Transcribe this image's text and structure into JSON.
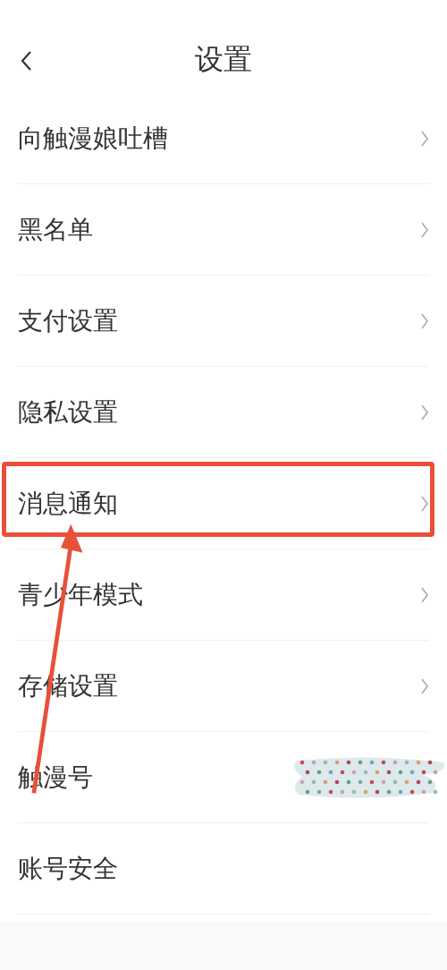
{
  "header": {
    "title": "设置"
  },
  "items": [
    {
      "label": "向触漫娘吐槽",
      "chevron": true,
      "highlighted": false,
      "redacted": false
    },
    {
      "label": "黑名单",
      "chevron": true,
      "highlighted": false,
      "redacted": false
    },
    {
      "label": "支付设置",
      "chevron": true,
      "highlighted": false,
      "redacted": false
    },
    {
      "label": "隐私设置",
      "chevron": true,
      "highlighted": false,
      "redacted": false
    },
    {
      "label": "消息通知",
      "chevron": true,
      "highlighted": true,
      "redacted": false
    },
    {
      "label": "青少年模式",
      "chevron": true,
      "highlighted": false,
      "redacted": false
    },
    {
      "label": "存储设置",
      "chevron": true,
      "highlighted": false,
      "redacted": false
    },
    {
      "label": "触漫号",
      "chevron": false,
      "highlighted": false,
      "redacted": true
    },
    {
      "label": "账号安全",
      "chevron": false,
      "highlighted": false,
      "redacted": false
    }
  ]
}
